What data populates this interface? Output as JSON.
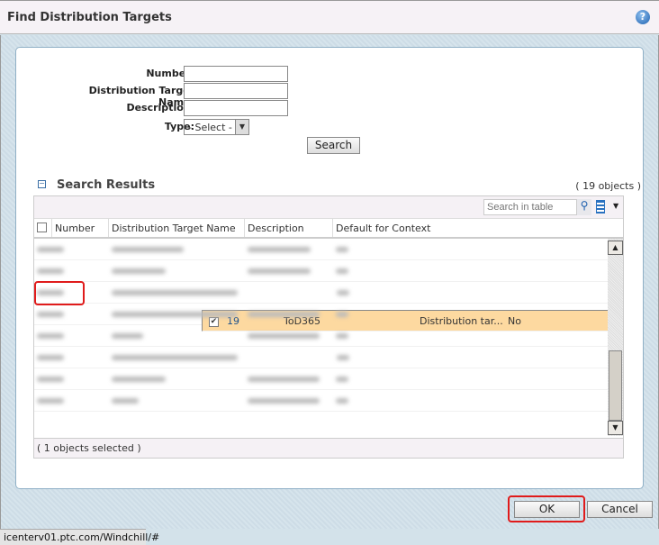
{
  "dialog": {
    "title": "Find Distribution Targets",
    "help_icon": "help-icon"
  },
  "form": {
    "number_label": "Number:",
    "number_value": "",
    "name_label": "Distribution Target Name:",
    "name_value": "",
    "description_label": "Description:",
    "description_value": "",
    "type_label": "Type:",
    "type_selected": "- Select -",
    "search_button": "Search"
  },
  "results": {
    "title": "Search Results",
    "count": "( 19 objects )",
    "table_search_placeholder": "Search in table",
    "columns": [
      "Number",
      "Distribution Target Name",
      "Description",
      "Default for Context"
    ],
    "selected_row": {
      "number": "19",
      "name": "ToD365",
      "description": "Distribution tar...",
      "default_for_context": "No",
      "checked": true
    },
    "footer": "( 1 objects selected )"
  },
  "buttons": {
    "ok": "OK",
    "cancel": "Cancel"
  },
  "status_bar": "icenterv01.ptc.com/Windchill/#",
  "colors": {
    "selected_row": "#fdd9a0",
    "highlight": "#e01b1b",
    "link": "#1a4f8b"
  }
}
